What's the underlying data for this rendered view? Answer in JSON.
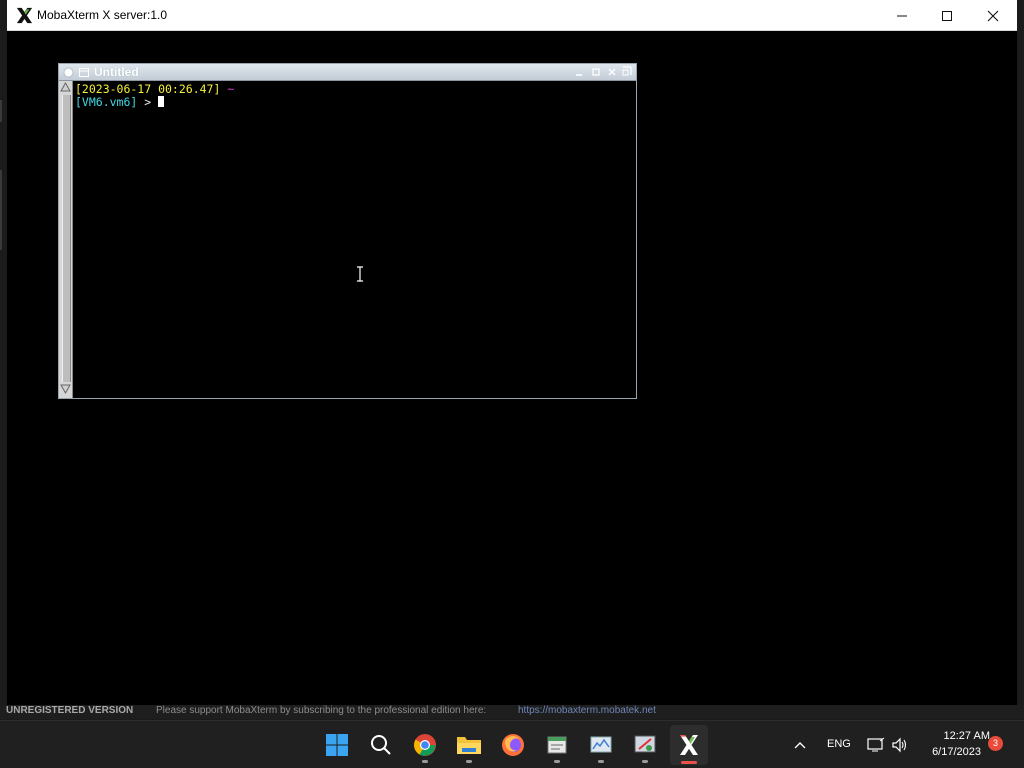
{
  "window": {
    "title": "MobaXterm X server:1.0"
  },
  "xwindow": {
    "title": "Untitled"
  },
  "terminal": {
    "line1_timestamp": "[2023-06-17 00:26.47]",
    "line1_path": "~",
    "line2_prompt": "[VM6.vm6]",
    "line2_arrow": ">"
  },
  "statusbar": {
    "unregistered": "UNREGISTERED VERSION",
    "message": "Please support MobaXterm by subscribing to the professional edition here:",
    "link": "https://mobaxterm.mobatek.net"
  },
  "taskbar": {
    "apps": [
      "start-icon",
      "search-icon",
      "chrome-icon",
      "file-explorer-icon",
      "firefox-icon",
      "notepad-icon",
      "task-manager-icon",
      "snipping-tool-icon",
      "mobaxterm-icon"
    ],
    "language": "ENG",
    "time": "12:27 AM",
    "date": "6/17/2023",
    "notification_count": "3"
  },
  "colors": {
    "prompt_timestamp": "#f7f03a",
    "prompt_host": "#3fd9e6",
    "prompt_path": "#d63bd0"
  }
}
